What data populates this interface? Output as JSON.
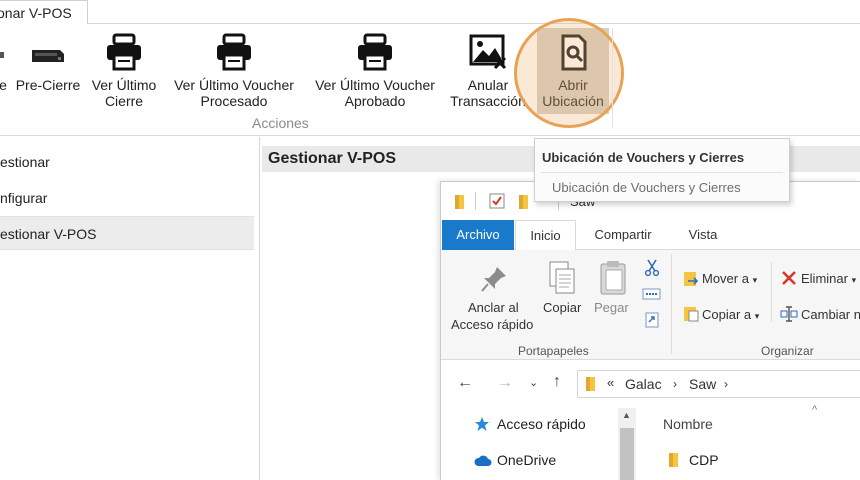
{
  "window": {
    "tab_label": "onar V-POS"
  },
  "ribbon": {
    "buttons": [
      {
        "label": "e"
      },
      {
        "label": "Pre-Cierre"
      },
      {
        "label": "Ver Último",
        "label2": "Cierre"
      },
      {
        "label": "Ver Último Voucher",
        "label2": "Procesado"
      },
      {
        "label": "Ver Último Voucher",
        "label2": "Aprobado"
      },
      {
        "label": "Anular",
        "label2": "Transacción"
      },
      {
        "label": "Abrir",
        "label2": "Ubicación"
      }
    ],
    "group_label": "Acciones"
  },
  "tooltip": {
    "title": "Ubicación de Vouchers y Cierres",
    "description": "Ubicación de Vouchers y Cierres"
  },
  "nav": {
    "items": [
      {
        "label": "estionar"
      },
      {
        "label": "nfigurar"
      },
      {
        "label": "estionar V-POS"
      }
    ]
  },
  "panel": {
    "title": "Gestionar V-POS"
  },
  "explorer": {
    "title": "Saw",
    "tabs": [
      "Archivo",
      "Inicio",
      "Compartir",
      "Vista"
    ],
    "portapapeles": {
      "anclar_line1": "Anclar al",
      "anclar_line2": "Acceso rápido",
      "copiar": "Copiar",
      "pegar": "Pegar",
      "group": "Portapapeles"
    },
    "organizar": {
      "mover": "Mover a",
      "copiar_a": "Copiar a",
      "eliminar": "Eliminar",
      "cambiar": "Cambiar n",
      "group": "Organizar"
    },
    "breadcrumb": {
      "prefix": "«",
      "items": [
        "Galac",
        "Saw"
      ]
    },
    "nav_items": [
      "Acceso rápido",
      "OneDrive"
    ],
    "list": {
      "header": "Nombre",
      "rows": [
        "CDP"
      ]
    }
  },
  "colors": {
    "highlight": "#e8a254",
    "archivo_tab": "#1979ca",
    "folder": "#f4c542"
  }
}
